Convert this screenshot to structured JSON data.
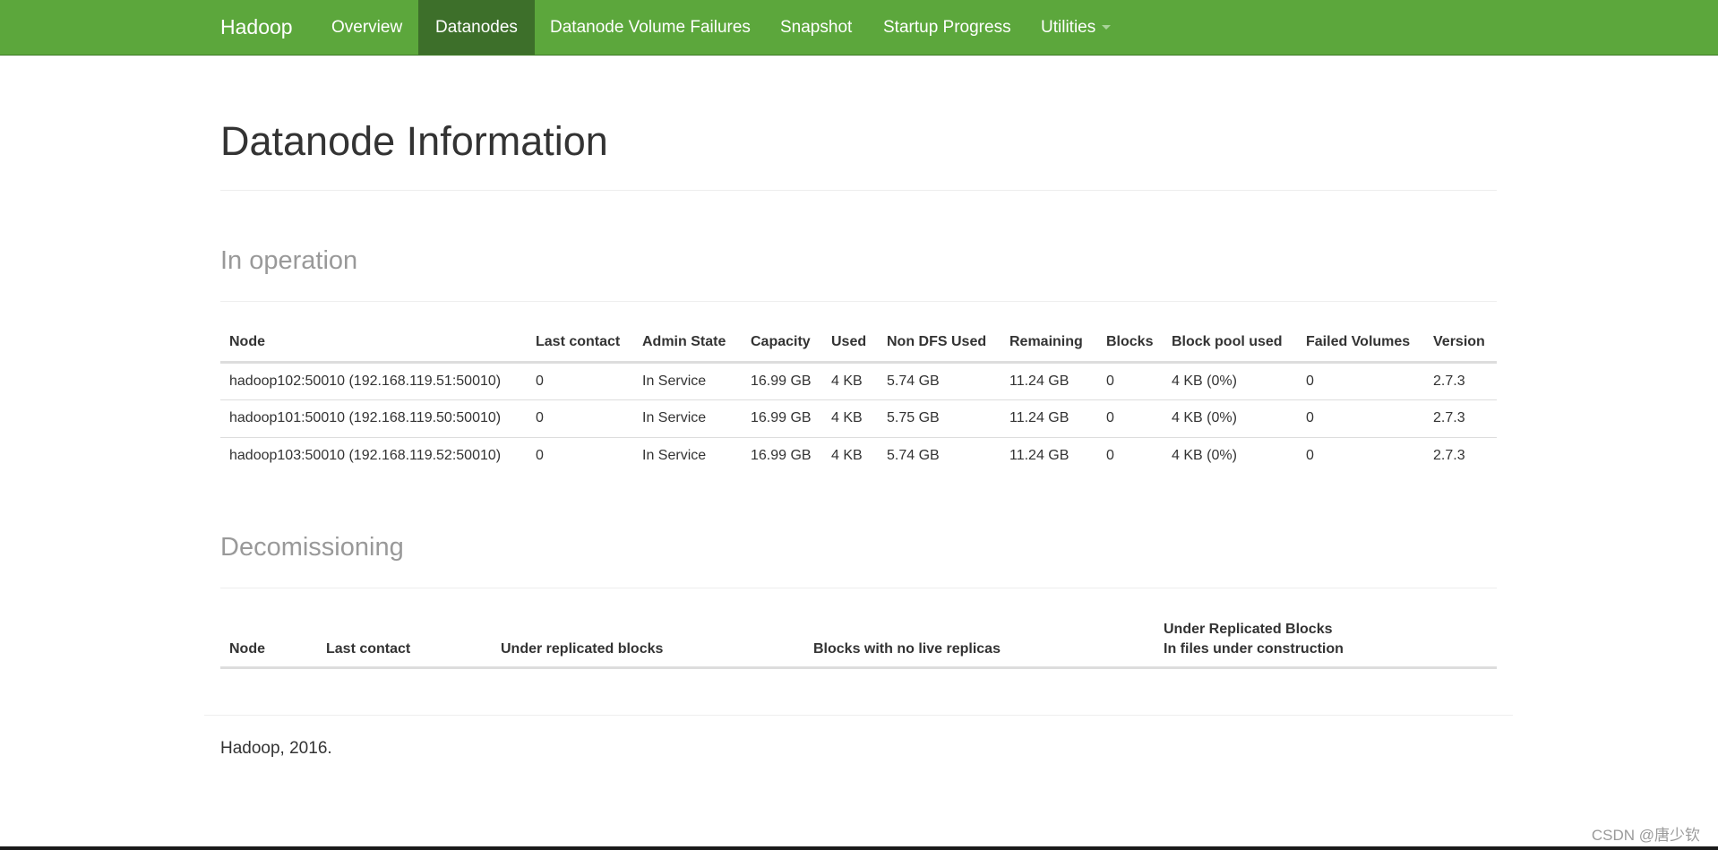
{
  "navbar": {
    "brand": "Hadoop",
    "items": [
      {
        "label": "Overview"
      },
      {
        "label": "Datanodes"
      },
      {
        "label": "Datanode Volume Failures"
      },
      {
        "label": "Snapshot"
      },
      {
        "label": "Startup Progress"
      },
      {
        "label": "Utilities"
      }
    ],
    "active": "Datanodes",
    "bg_color": "#5ca73c",
    "active_color": "#3d6f2a"
  },
  "page": {
    "title": "Datanode Information"
  },
  "in_operation": {
    "title": "In operation",
    "columns": [
      "Node",
      "Last contact",
      "Admin State",
      "Capacity",
      "Used",
      "Non DFS Used",
      "Remaining",
      "Blocks",
      "Block pool used",
      "Failed Volumes",
      "Version"
    ],
    "rows": [
      [
        "hadoop102:50010 (192.168.119.51:50010)",
        "0",
        "In Service",
        "16.99 GB",
        "4 KB",
        "5.74 GB",
        "11.24 GB",
        "0",
        "4 KB (0%)",
        "0",
        "2.7.3"
      ],
      [
        "hadoop101:50010 (192.168.119.50:50010)",
        "0",
        "In Service",
        "16.99 GB",
        "4 KB",
        "5.75 GB",
        "11.24 GB",
        "0",
        "4 KB (0%)",
        "0",
        "2.7.3"
      ],
      [
        "hadoop103:50010 (192.168.119.52:50010)",
        "0",
        "In Service",
        "16.99 GB",
        "4 KB",
        "5.74 GB",
        "11.24 GB",
        "0",
        "4 KB (0%)",
        "0",
        "2.7.3"
      ]
    ]
  },
  "decomissioning": {
    "title": "Decomissioning",
    "columns": [
      "Node",
      "Last contact",
      "Under replicated blocks",
      "Blocks with no live replicas"
    ],
    "last_column_line1": "Under Replicated Blocks",
    "last_column_line2": "In files under construction"
  },
  "footer": {
    "text": "Hadoop, 2016."
  },
  "watermark": "CSDN @唐少钦"
}
